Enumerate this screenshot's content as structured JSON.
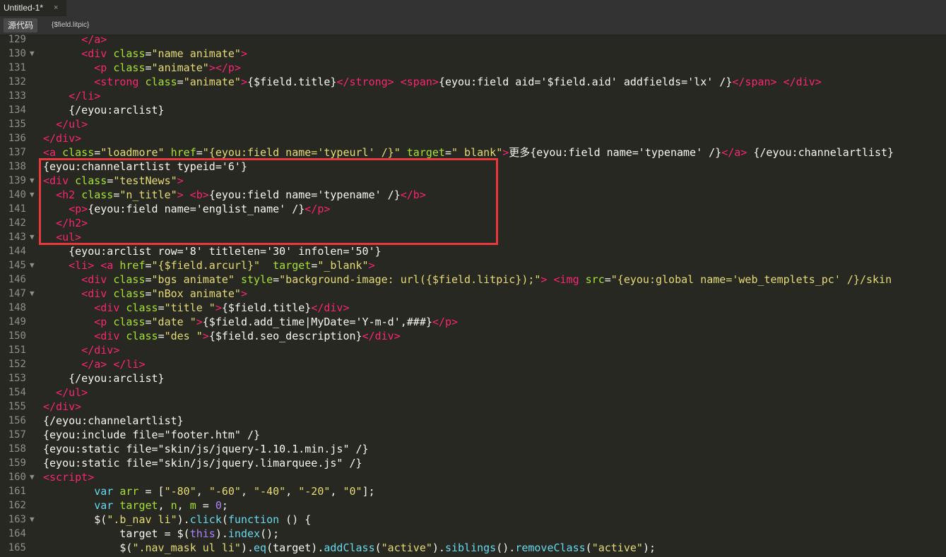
{
  "tab": {
    "title": "Untitled-1*",
    "close_glyph": "×"
  },
  "toolbar": {
    "source_button": "源代码",
    "related_file": "{$field.litpic}"
  },
  "colors": {
    "background": "#272822",
    "tag": "#f92672",
    "attribute": "#a6e22e",
    "string": "#e6db74",
    "keyword": "#66d9ef",
    "number": "#ae81ff",
    "highlight_box": "#e8383b"
  },
  "lines": [
    {
      "num": "129",
      "fold": false,
      "parts": [
        [
          "p",
          "      "
        ],
        [
          "t",
          "</a>"
        ]
      ]
    },
    {
      "num": "130",
      "fold": true,
      "parts": [
        [
          "p",
          "      "
        ],
        [
          "t",
          "<div "
        ],
        [
          "a",
          "class"
        ],
        [
          "p",
          "="
        ],
        [
          "s",
          "\"name animate\""
        ],
        [
          "t",
          ">"
        ]
      ]
    },
    {
      "num": "131",
      "fold": false,
      "parts": [
        [
          "p",
          "        "
        ],
        [
          "t",
          "<p "
        ],
        [
          "a",
          "class"
        ],
        [
          "p",
          "="
        ],
        [
          "s",
          "\"animate\""
        ],
        [
          "t",
          "></p>"
        ]
      ]
    },
    {
      "num": "132",
      "fold": false,
      "parts": [
        [
          "p",
          "        "
        ],
        [
          "t",
          "<strong "
        ],
        [
          "a",
          "class"
        ],
        [
          "p",
          "="
        ],
        [
          "s",
          "\"animate\""
        ],
        [
          "t",
          ">"
        ],
        [
          "p",
          "{$field.title}"
        ],
        [
          "t",
          "</strong>"
        ],
        [
          "p",
          " "
        ],
        [
          "t",
          "<span>"
        ],
        [
          "p",
          "{eyou:field aid='$field.aid' addfields='lx' /}"
        ],
        [
          "t",
          "</span>"
        ],
        [
          "p",
          " "
        ],
        [
          "t",
          "</div>"
        ]
      ]
    },
    {
      "num": "133",
      "fold": false,
      "parts": [
        [
          "p",
          "    "
        ],
        [
          "t",
          "</li>"
        ]
      ]
    },
    {
      "num": "134",
      "fold": false,
      "parts": [
        [
          "p",
          "    {/eyou:arclist}"
        ]
      ]
    },
    {
      "num": "135",
      "fold": false,
      "parts": [
        [
          "p",
          "  "
        ],
        [
          "t",
          "</ul>"
        ]
      ]
    },
    {
      "num": "136",
      "fold": false,
      "parts": [
        [
          "t",
          "</div>"
        ]
      ]
    },
    {
      "num": "137",
      "fold": false,
      "parts": [
        [
          "t",
          "<a "
        ],
        [
          "a",
          "class"
        ],
        [
          "p",
          "="
        ],
        [
          "s",
          "\"loadmore\""
        ],
        [
          "p",
          " "
        ],
        [
          "a",
          "href"
        ],
        [
          "p",
          "="
        ],
        [
          "s",
          "\"{eyou:field name='typeurl' /}\""
        ],
        [
          "p",
          " "
        ],
        [
          "a",
          "target"
        ],
        [
          "p",
          "="
        ],
        [
          "s",
          "\"_blank\""
        ],
        [
          "t",
          ">"
        ],
        [
          "p",
          "更多{eyou:field name='typename' /}"
        ],
        [
          "t",
          "</a>"
        ],
        [
          "p",
          " {/eyou:channelartlist}"
        ]
      ]
    },
    {
      "num": "138",
      "fold": false,
      "parts": [
        [
          "p",
          "{eyou:channelartlist typeid='6'}"
        ]
      ]
    },
    {
      "num": "139",
      "fold": true,
      "parts": [
        [
          "t",
          "<div "
        ],
        [
          "a",
          "class"
        ],
        [
          "p",
          "="
        ],
        [
          "s",
          "\"testNews\""
        ],
        [
          "t",
          ">"
        ]
      ]
    },
    {
      "num": "140",
      "fold": true,
      "parts": [
        [
          "p",
          "  "
        ],
        [
          "t",
          "<h2 "
        ],
        [
          "a",
          "class"
        ],
        [
          "p",
          "="
        ],
        [
          "s",
          "\"n_title\""
        ],
        [
          "t",
          ">"
        ],
        [
          "p",
          " "
        ],
        [
          "t",
          "<b>"
        ],
        [
          "p",
          "{eyou:field name='typename' /}"
        ],
        [
          "t",
          "</b>"
        ]
      ]
    },
    {
      "num": "141",
      "fold": false,
      "parts": [
        [
          "p",
          "    "
        ],
        [
          "t",
          "<p>"
        ],
        [
          "p",
          "{eyou:field name='englist_name' /}"
        ],
        [
          "t",
          "</p>"
        ]
      ]
    },
    {
      "num": "142",
      "fold": false,
      "parts": [
        [
          "p",
          "  "
        ],
        [
          "t",
          "</h2>"
        ]
      ]
    },
    {
      "num": "143",
      "fold": true,
      "parts": [
        [
          "p",
          "  "
        ],
        [
          "t",
          "<ul>"
        ]
      ]
    },
    {
      "num": "144",
      "fold": false,
      "parts": [
        [
          "p",
          "    {eyou:arclist row='8' titlelen='30' infolen='50'}"
        ]
      ]
    },
    {
      "num": "145",
      "fold": true,
      "parts": [
        [
          "p",
          "    "
        ],
        [
          "t",
          "<li>"
        ],
        [
          "p",
          " "
        ],
        [
          "t",
          "<a "
        ],
        [
          "a",
          "href"
        ],
        [
          "p",
          "="
        ],
        [
          "s",
          "\"{$field.arcurl}\""
        ],
        [
          "p",
          "  "
        ],
        [
          "a",
          "target"
        ],
        [
          "p",
          "="
        ],
        [
          "s",
          "\"_blank\""
        ],
        [
          "t",
          ">"
        ]
      ]
    },
    {
      "num": "146",
      "fold": false,
      "parts": [
        [
          "p",
          "      "
        ],
        [
          "t",
          "<div "
        ],
        [
          "a",
          "class"
        ],
        [
          "p",
          "="
        ],
        [
          "s",
          "\"bgs animate\""
        ],
        [
          "p",
          " "
        ],
        [
          "a",
          "style"
        ],
        [
          "p",
          "="
        ],
        [
          "s",
          "\"background-image: url({$field.litpic});\""
        ],
        [
          "t",
          ">"
        ],
        [
          "p",
          " "
        ],
        [
          "t",
          "<img "
        ],
        [
          "a",
          "src"
        ],
        [
          "p",
          "="
        ],
        [
          "s",
          "\"{eyou:global name='web_templets_pc' /}/skin"
        ]
      ]
    },
    {
      "num": "147",
      "fold": true,
      "parts": [
        [
          "p",
          "      "
        ],
        [
          "t",
          "<div "
        ],
        [
          "a",
          "class"
        ],
        [
          "p",
          "="
        ],
        [
          "s",
          "\"nBox animate\""
        ],
        [
          "t",
          ">"
        ]
      ]
    },
    {
      "num": "148",
      "fold": false,
      "parts": [
        [
          "p",
          "        "
        ],
        [
          "t",
          "<div "
        ],
        [
          "a",
          "class"
        ],
        [
          "p",
          "="
        ],
        [
          "s",
          "\"title \""
        ],
        [
          "t",
          ">"
        ],
        [
          "p",
          "{$field.title}"
        ],
        [
          "t",
          "</div>"
        ]
      ]
    },
    {
      "num": "149",
      "fold": false,
      "parts": [
        [
          "p",
          "        "
        ],
        [
          "t",
          "<p "
        ],
        [
          "a",
          "class"
        ],
        [
          "p",
          "="
        ],
        [
          "s",
          "\"date \""
        ],
        [
          "t",
          ">"
        ],
        [
          "p",
          "{$field.add_time|MyDate='Y-m-d',###}"
        ],
        [
          "t",
          "</p>"
        ]
      ]
    },
    {
      "num": "150",
      "fold": false,
      "parts": [
        [
          "p",
          "        "
        ],
        [
          "t",
          "<div "
        ],
        [
          "a",
          "class"
        ],
        [
          "p",
          "="
        ],
        [
          "s",
          "\"des \""
        ],
        [
          "t",
          ">"
        ],
        [
          "p",
          "{$field.seo_description}"
        ],
        [
          "t",
          "</div>"
        ]
      ]
    },
    {
      "num": "151",
      "fold": false,
      "parts": [
        [
          "p",
          "      "
        ],
        [
          "t",
          "</div>"
        ]
      ]
    },
    {
      "num": "152",
      "fold": false,
      "parts": [
        [
          "p",
          "      "
        ],
        [
          "t",
          "</a>"
        ],
        [
          "p",
          " "
        ],
        [
          "t",
          "</li>"
        ]
      ]
    },
    {
      "num": "153",
      "fold": false,
      "parts": [
        [
          "p",
          "    {/eyou:arclist}"
        ]
      ]
    },
    {
      "num": "154",
      "fold": false,
      "parts": [
        [
          "p",
          "  "
        ],
        [
          "t",
          "</ul>"
        ]
      ]
    },
    {
      "num": "155",
      "fold": false,
      "parts": [
        [
          "t",
          "</div>"
        ]
      ]
    },
    {
      "num": "156",
      "fold": false,
      "parts": [
        [
          "p",
          "{/eyou:channelartlist}"
        ]
      ]
    },
    {
      "num": "157",
      "fold": false,
      "parts": [
        [
          "p",
          "{eyou:include file=\"footer.htm\" /}"
        ]
      ]
    },
    {
      "num": "158",
      "fold": false,
      "parts": [
        [
          "p",
          "{eyou:static file=\"skin/js/jquery-1.10.1.min.js\" /}"
        ]
      ]
    },
    {
      "num": "159",
      "fold": false,
      "parts": [
        [
          "p",
          "{eyou:static file=\"skin/js/jquery.limarquee.js\" /}"
        ]
      ]
    },
    {
      "num": "160",
      "fold": true,
      "parts": [
        [
          "t",
          "<script>"
        ]
      ]
    },
    {
      "num": "161",
      "fold": false,
      "parts": [
        [
          "p",
          "        "
        ],
        [
          "k",
          "var "
        ],
        [
          "a",
          "arr"
        ],
        [
          "p",
          " = ["
        ],
        [
          "s",
          "\"-80\""
        ],
        [
          "p",
          ", "
        ],
        [
          "s",
          "\"-60\""
        ],
        [
          "p",
          ", "
        ],
        [
          "s",
          "\"-40\""
        ],
        [
          "p",
          ", "
        ],
        [
          "s",
          "\"-20\""
        ],
        [
          "p",
          ", "
        ],
        [
          "s",
          "\"0\""
        ],
        [
          "p",
          "];"
        ]
      ]
    },
    {
      "num": "162",
      "fold": false,
      "parts": [
        [
          "p",
          "        "
        ],
        [
          "k",
          "var "
        ],
        [
          "a",
          "target"
        ],
        [
          "p",
          ", "
        ],
        [
          "a",
          "n"
        ],
        [
          "p",
          ", "
        ],
        [
          "a",
          "m"
        ],
        [
          "p",
          " = "
        ],
        [
          "n",
          "0"
        ],
        [
          "p",
          ";"
        ]
      ]
    },
    {
      "num": "163",
      "fold": true,
      "parts": [
        [
          "p",
          "        $("
        ],
        [
          "s",
          "\".b_nav li\""
        ],
        [
          "p",
          ")."
        ],
        [
          "k",
          "click"
        ],
        [
          "p",
          "("
        ],
        [
          "k",
          "function"
        ],
        [
          "p",
          " () {"
        ]
      ]
    },
    {
      "num": "164",
      "fold": false,
      "parts": [
        [
          "p",
          "            target = $("
        ],
        [
          "n",
          "this"
        ],
        [
          "p",
          ")."
        ],
        [
          "k",
          "index"
        ],
        [
          "p",
          "();"
        ]
      ]
    },
    {
      "num": "165",
      "fold": false,
      "parts": [
        [
          "p",
          "            $("
        ],
        [
          "s",
          "\".nav_mask ul li\""
        ],
        [
          "p",
          ")."
        ],
        [
          "k",
          "eq"
        ],
        [
          "p",
          "(target)."
        ],
        [
          "k",
          "addClass"
        ],
        [
          "p",
          "("
        ],
        [
          "s",
          "\"active\""
        ],
        [
          "p",
          ")."
        ],
        [
          "k",
          "siblings"
        ],
        [
          "p",
          "()."
        ],
        [
          "k",
          "removeClass"
        ],
        [
          "p",
          "("
        ],
        [
          "s",
          "\"active\""
        ],
        [
          "p",
          ");"
        ]
      ]
    }
  ]
}
